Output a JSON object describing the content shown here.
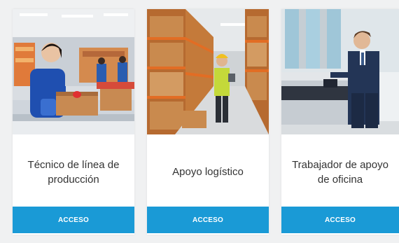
{
  "cards": [
    {
      "title": "Técnico de línea de producción",
      "button_label": "ACCESO"
    },
    {
      "title": "Apoyo logístico",
      "button_label": "ACCESO"
    },
    {
      "title": "Trabajador de apoyo de oficina",
      "button_label": "ACCESO"
    }
  ],
  "colors": {
    "button": "#1a9ad6",
    "button_text": "#ffffff",
    "title_text": "#333333",
    "page_background": "#f0f1f2"
  }
}
